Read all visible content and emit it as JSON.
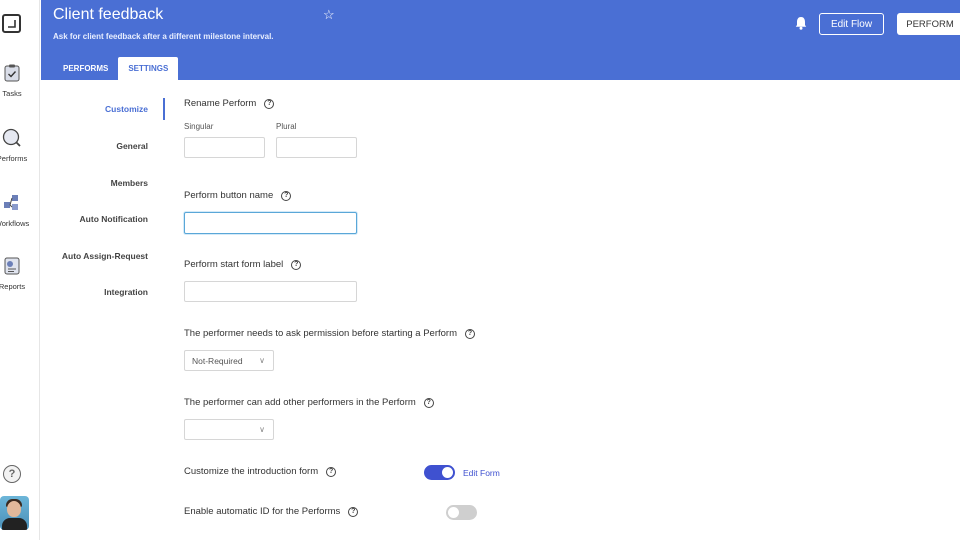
{
  "rail": {
    "items": [
      {
        "label": "Tasks",
        "icon": "clipboard-icon"
      },
      {
        "label": "Performs",
        "icon": "search-icon"
      },
      {
        "label": "Workflows",
        "icon": "workflow-icon"
      },
      {
        "label": "Reports",
        "icon": "report-icon"
      }
    ],
    "help": "?"
  },
  "header": {
    "title": "Client feedback",
    "subtitle": "Ask for client feedback after a different milestone interval.",
    "edit_flow": "Edit Flow",
    "perform": "PERFORM",
    "tabs": [
      {
        "label": "PERFORMS",
        "active": false
      },
      {
        "label": "SETTINGS",
        "active": true
      }
    ],
    "accent": "#4a6fd4"
  },
  "settings_nav": [
    {
      "label": "Customize",
      "active": true
    },
    {
      "label": "General",
      "active": false
    },
    {
      "label": "Members",
      "active": false
    },
    {
      "label": "Auto Notification",
      "active": false
    },
    {
      "label": "Auto Assign-Request",
      "active": false
    },
    {
      "label": "Integration",
      "active": false
    }
  ],
  "form": {
    "rename": {
      "label": "Rename Perform",
      "singular": "Singular",
      "plural": "Plural",
      "singular_value": "",
      "plural_value": ""
    },
    "button_name": {
      "label": "Perform button name",
      "value": ""
    },
    "start_form": {
      "label": "Perform start form label",
      "value": ""
    },
    "permission": {
      "label": "The performer needs to ask permission before starting a Perform",
      "selected": "Not-Required"
    },
    "add_performers": {
      "label": "The performer can add other performers in the Perform",
      "selected": ""
    },
    "intro_form": {
      "label": "Customize the introduction form",
      "enabled": true,
      "link": "Edit Form"
    },
    "auto_id": {
      "label": "Enable automatic ID for the Performs",
      "enabled": false
    }
  }
}
